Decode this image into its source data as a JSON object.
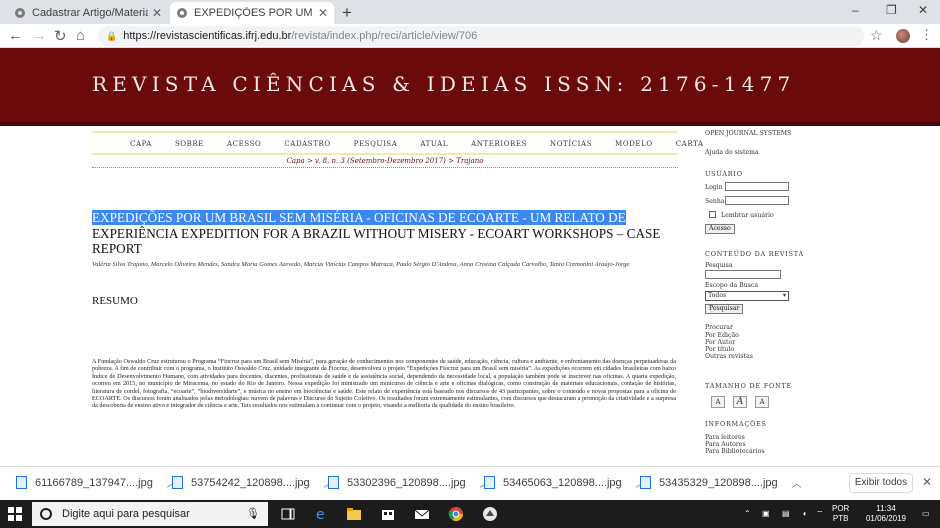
{
  "browser": {
    "tabs": [
      {
        "title": "Cadastrar Artigo/Material Didáti",
        "active": false
      },
      {
        "title": "EXPEDIÇÕES POR UM BRASIL SEM M",
        "active": true
      }
    ],
    "new_tab": "+",
    "window": {
      "minimize": "–",
      "restore": "❐",
      "close": "✕"
    },
    "url_host": "https://revistascientificas.ifrj.edu.br",
    "url_path": "/revista/index.php/reci/article/view/706"
  },
  "journal": {
    "title": "REVISTA CIÊNCIAS & IDEIAS ISSN: 2176-1477",
    "nav": [
      "CAPA",
      "SOBRE",
      "ACESSO",
      "CADASTRO",
      "PESQUISA",
      "ATUAL",
      "ANTERIORES",
      "NOTÍCIAS",
      "MODELO",
      "CARTA"
    ],
    "breadcrumb": {
      "capa": "Capa",
      "sep1": " > ",
      "issue": "v. 8, n. 3 (Setembro-Dezembro 2017)",
      "sep2": " > ",
      "current": "Trajano"
    }
  },
  "article": {
    "title_selected": "EXPEDIÇÕES POR UM BRASIL SEM MISÉRIA - OFICINAS DE ECOARTE - UM RELATO DE",
    "title_rest": "EXPERIÊNCIA EXPEDITION FOR A BRAZIL WITHOUT MISERY - ECOART WORKSHOPS – CASE REPORT",
    "authors": "Valéria Silva Trajano, Marcelo Oliveira Mendes, Sandra Maria Gomes Azevedo, Marcus Vinícius Campos Matraca, Paulo Sérgio D'Andrea, Anna Cristina Calçada Carvalho, Tania Cremonini Araújo-Jorge",
    "resumo_heading": "RESUMO",
    "abstract": "A Fundação Oswaldo Cruz estruturou o Programa “Fiocruz para um Brasil sem Miséria”, para geração de conhecimentos nos componentes de saúde, educação, ciência, cultura e ambiente, e enfrentamento das doenças perpetuadoras da pobreza. A fim de contribuir com o programa, o Instituto Oswaldo Cruz, unidade integrante da Fiocruz, desenvolveu o projeto “Expedições Fiocruz para um Brasil sem miséria”. As expedições ocorrem em cidades brasileiras com baixo Índice de Desenvolvimento Humano, com atividades para docentes, discentes, profissionais de saúde e da assistência social, dependendo da necessidade local, a população também pode se inscrever nas oficinas. A quarta expedição, ocorreu em 2015, no município de Miracema, no estado do Rio de Janeiro. Nessa expedição foi ministrado um minicurso de ciência e arte e oficinas dialógicas, como construção de materiais educacionais, contação de histórias, literatura de cordel, fotografia, “ecoarte”, “biodiversidarte”, e música no ensino em biociências e saúde. Este relato de experiência está baseado nos discursos de 43 participantes, sobre o conteúdo e novas propostas para a oficina de ECOARTE. Os discursos foram analisados pelas metodologias: nuvem de palavras e Discurso do Sujeito Coletivo. Os resultados foram extremamente estimulantes, com discursos que destacaram a promoção da criatividade e a surpresa da descoberta de ensino ativo e integrador de ciência e arte. Tais resultados nos estimulam a continuar com o projeto, visando a melhoria da qualidade do ensino brasileiro."
  },
  "sidebar": {
    "ojs": "OPEN JOURNAL SYSTEMS",
    "help": "Ajuda do sistema",
    "user_header": "USUÁRIO",
    "login_label": "Login",
    "password_label": "Senha",
    "remember": "Lembrar usuário",
    "access_button": "Acesso",
    "content_header": "CONTEÚDO DA REVISTA",
    "search_label": "Pesquisa",
    "scope_label": "Escopo da Busca",
    "scope_value": "Todos",
    "search_button": "Pesquisar",
    "browse_label": "Procurar",
    "browse_links": [
      "Por Edição",
      "Por Autor",
      "Por título",
      "Outras revistas"
    ],
    "font_header": "TAMANHO DE FONTE",
    "font_buttons": [
      "A",
      "A",
      "A"
    ],
    "info_header": "INFORMAÇÕES",
    "info_links": [
      "Para leitores",
      "Para Autores",
      "Para Bibliotecários"
    ]
  },
  "downloads": {
    "items": [
      "61166789_137947....jpg",
      "53754242_120898....jpg",
      "53302396_120898....jpg",
      "53465063_120898....jpg",
      "53435329_120898....jpg"
    ],
    "show_all": "Exibir todos"
  },
  "taskbar": {
    "search_placeholder": "Digite aqui para pesquisar",
    "lang_top": "POR",
    "lang_bottom": "PTB",
    "time": "11:34",
    "date": "01/06/2019"
  },
  "colors": {
    "banner": "#6b0a0b",
    "selection": "#3b88f0",
    "nav_rule": "#eceea6"
  }
}
